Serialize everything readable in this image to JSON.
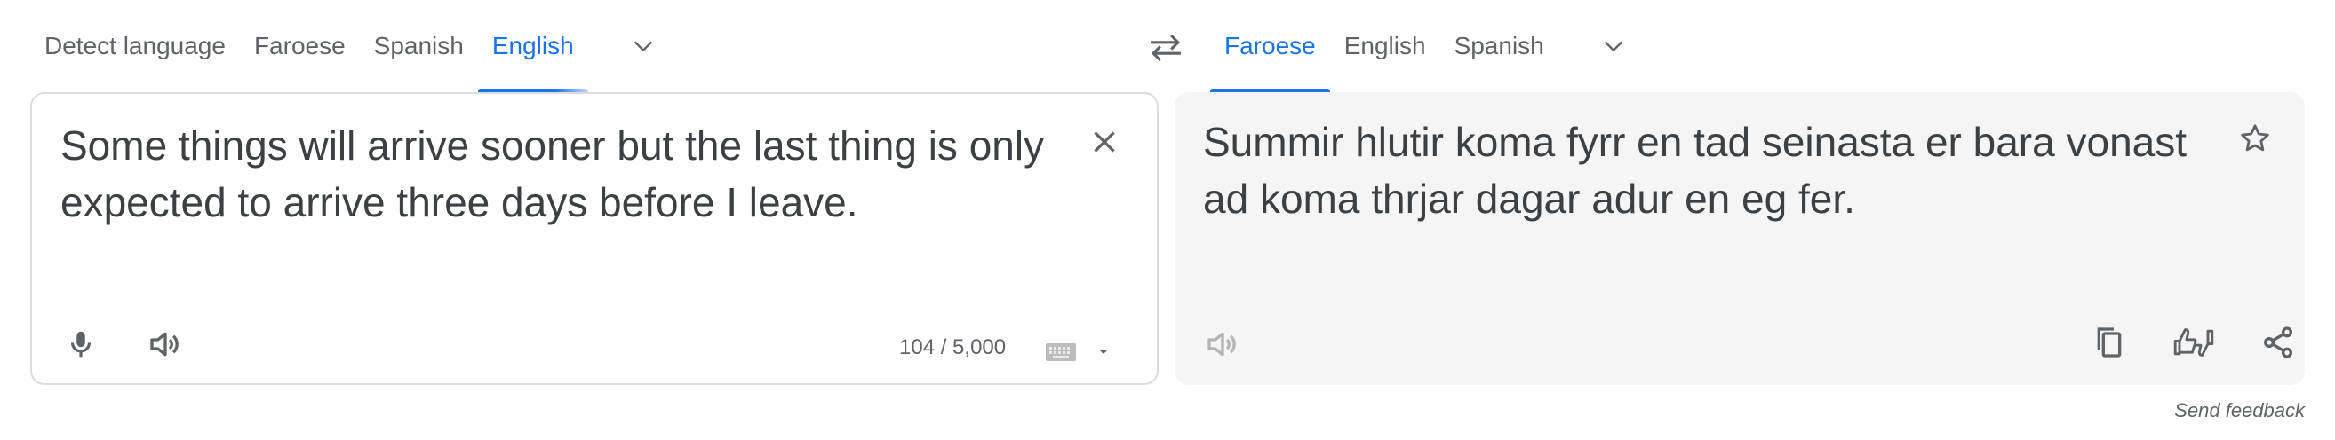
{
  "source_languages": {
    "tabs": [
      {
        "label": "Detect language"
      },
      {
        "label": "Faroese"
      },
      {
        "label": "Spanish"
      },
      {
        "label": "English"
      }
    ],
    "active_index": 3
  },
  "target_languages": {
    "tabs": [
      {
        "label": "Faroese"
      },
      {
        "label": "English"
      },
      {
        "label": "Spanish"
      }
    ],
    "active_index": 0
  },
  "source": {
    "text": "Some things will arrive sooner but the last thing is only expected to arrive three days before I leave.",
    "char_count": "104 / 5,000"
  },
  "target": {
    "text": "Summir hlutir koma fyrr en tad seinasta er bara vonast ad koma thrjar dagar adur en eg fer."
  },
  "footer": {
    "feedback_label": "Send feedback"
  },
  "icons": {
    "source_language_more": "chevron-down-icon",
    "swap": "swap-icon",
    "target_language_more": "chevron-down-icon",
    "clear": "close-icon",
    "mic": "mic-icon",
    "listen_source": "speaker-icon",
    "keyboard": "keyboard-icon",
    "star": "star-icon",
    "listen_target": "speaker-icon",
    "copy": "copy-icon",
    "rate": "thumbs-icon",
    "share": "share-icon"
  },
  "colors": {
    "accent": "#1a73e8",
    "text": "#3c4043",
    "muted": "#5f6368",
    "border": "#dadce0",
    "target_panel_bg": "#f5f5f5"
  }
}
